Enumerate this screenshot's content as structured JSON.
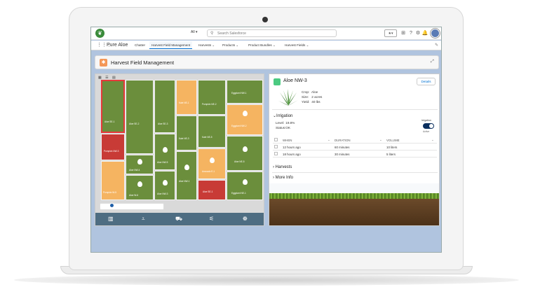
{
  "topbar": {
    "search_scope": "All",
    "search_placeholder": "Search Salesforce"
  },
  "nav": {
    "app_name": "Pure Aloe",
    "items": [
      {
        "label": "Chatter",
        "has_dropdown": false
      },
      {
        "label": "Harvest Field Management",
        "has_dropdown": false,
        "active": true
      },
      {
        "label": "Harvests",
        "has_dropdown": true
      },
      {
        "label": "Products",
        "has_dropdown": true
      },
      {
        "label": "Product Bundles",
        "has_dropdown": true
      },
      {
        "label": "Harvest Fields",
        "has_dropdown": true
      }
    ]
  },
  "page": {
    "title": "Harvest Field Management"
  },
  "map": {
    "fields": [
      {
        "label": "Aloe SE-1",
        "color": "red-outline",
        "watered": false
      },
      {
        "label": "Aloe SE-2",
        "color": "green",
        "watered": false
      },
      {
        "label": "Aloe SE-3",
        "color": "green",
        "watered": false
      },
      {
        "label": "Kale NE-1",
        "color": "orange",
        "watered": false
      },
      {
        "label": "Pumpkin NE-2",
        "color": "green",
        "watered": false
      },
      {
        "label": "Eggplant NW-1",
        "color": "green",
        "watered": false
      },
      {
        "label": "Eggplant NW-2",
        "color": "orange",
        "watered": true
      },
      {
        "label": "Pumpkin NW-3",
        "color": "red",
        "watered": false
      },
      {
        "label": "Aloe NW-4",
        "color": "green",
        "watered": true
      },
      {
        "label": "Aloe NW-5",
        "color": "green",
        "watered": true
      },
      {
        "label": "Kale NE-3",
        "color": "green",
        "watered": true
      },
      {
        "label": "Kale NE-5",
        "color": "green",
        "watered": false
      },
      {
        "label": "Aloe NE-5",
        "color": "green",
        "watered": true
      },
      {
        "label": "Avocado E-1",
        "color": "orange",
        "watered": true
      },
      {
        "label": "Pumpkin W-5",
        "color": "orange",
        "watered": false
      },
      {
        "label": "Aloe W-6",
        "color": "green",
        "watered": true
      },
      {
        "label": "Aloe NW-3",
        "color": "green",
        "watered": true
      },
      {
        "label": "Aloe NW-1",
        "color": "green",
        "watered": true
      },
      {
        "label": "Aloe SE-1",
        "color": "red",
        "watered": false
      },
      {
        "label": "Eggplant NE-1",
        "color": "green",
        "watered": true
      }
    ],
    "bottom_icons": [
      "field-icon",
      "harvest-icon",
      "tractor-icon",
      "sprayer-icon",
      "tree-icon"
    ]
  },
  "detail": {
    "title": "Aloe NW-3",
    "details_button": "Details",
    "crop_label": "Crop:",
    "crop_value": "Aloe",
    "size_label": "Size:",
    "size_value": "2 acres",
    "yield_label": "Yield:",
    "yield_value": "40 lbs",
    "irrigation_section": "Irrigation",
    "level_label": "Level:",
    "level_value": "19.8%",
    "status_label": "Status:",
    "status_value": "OK",
    "irrigation_toggle_label": "Irrigation",
    "irrigation_toggle_state": "Active",
    "table": {
      "headers": [
        "When",
        "Duration",
        "Volume"
      ],
      "rows": [
        [
          "12 hours ago",
          "60 minutes",
          "10 liters"
        ],
        [
          "18 hours ago",
          "30 minutes",
          "5 liters"
        ]
      ]
    },
    "harvests_section": "Harvests",
    "more_info_section": "More Info"
  }
}
